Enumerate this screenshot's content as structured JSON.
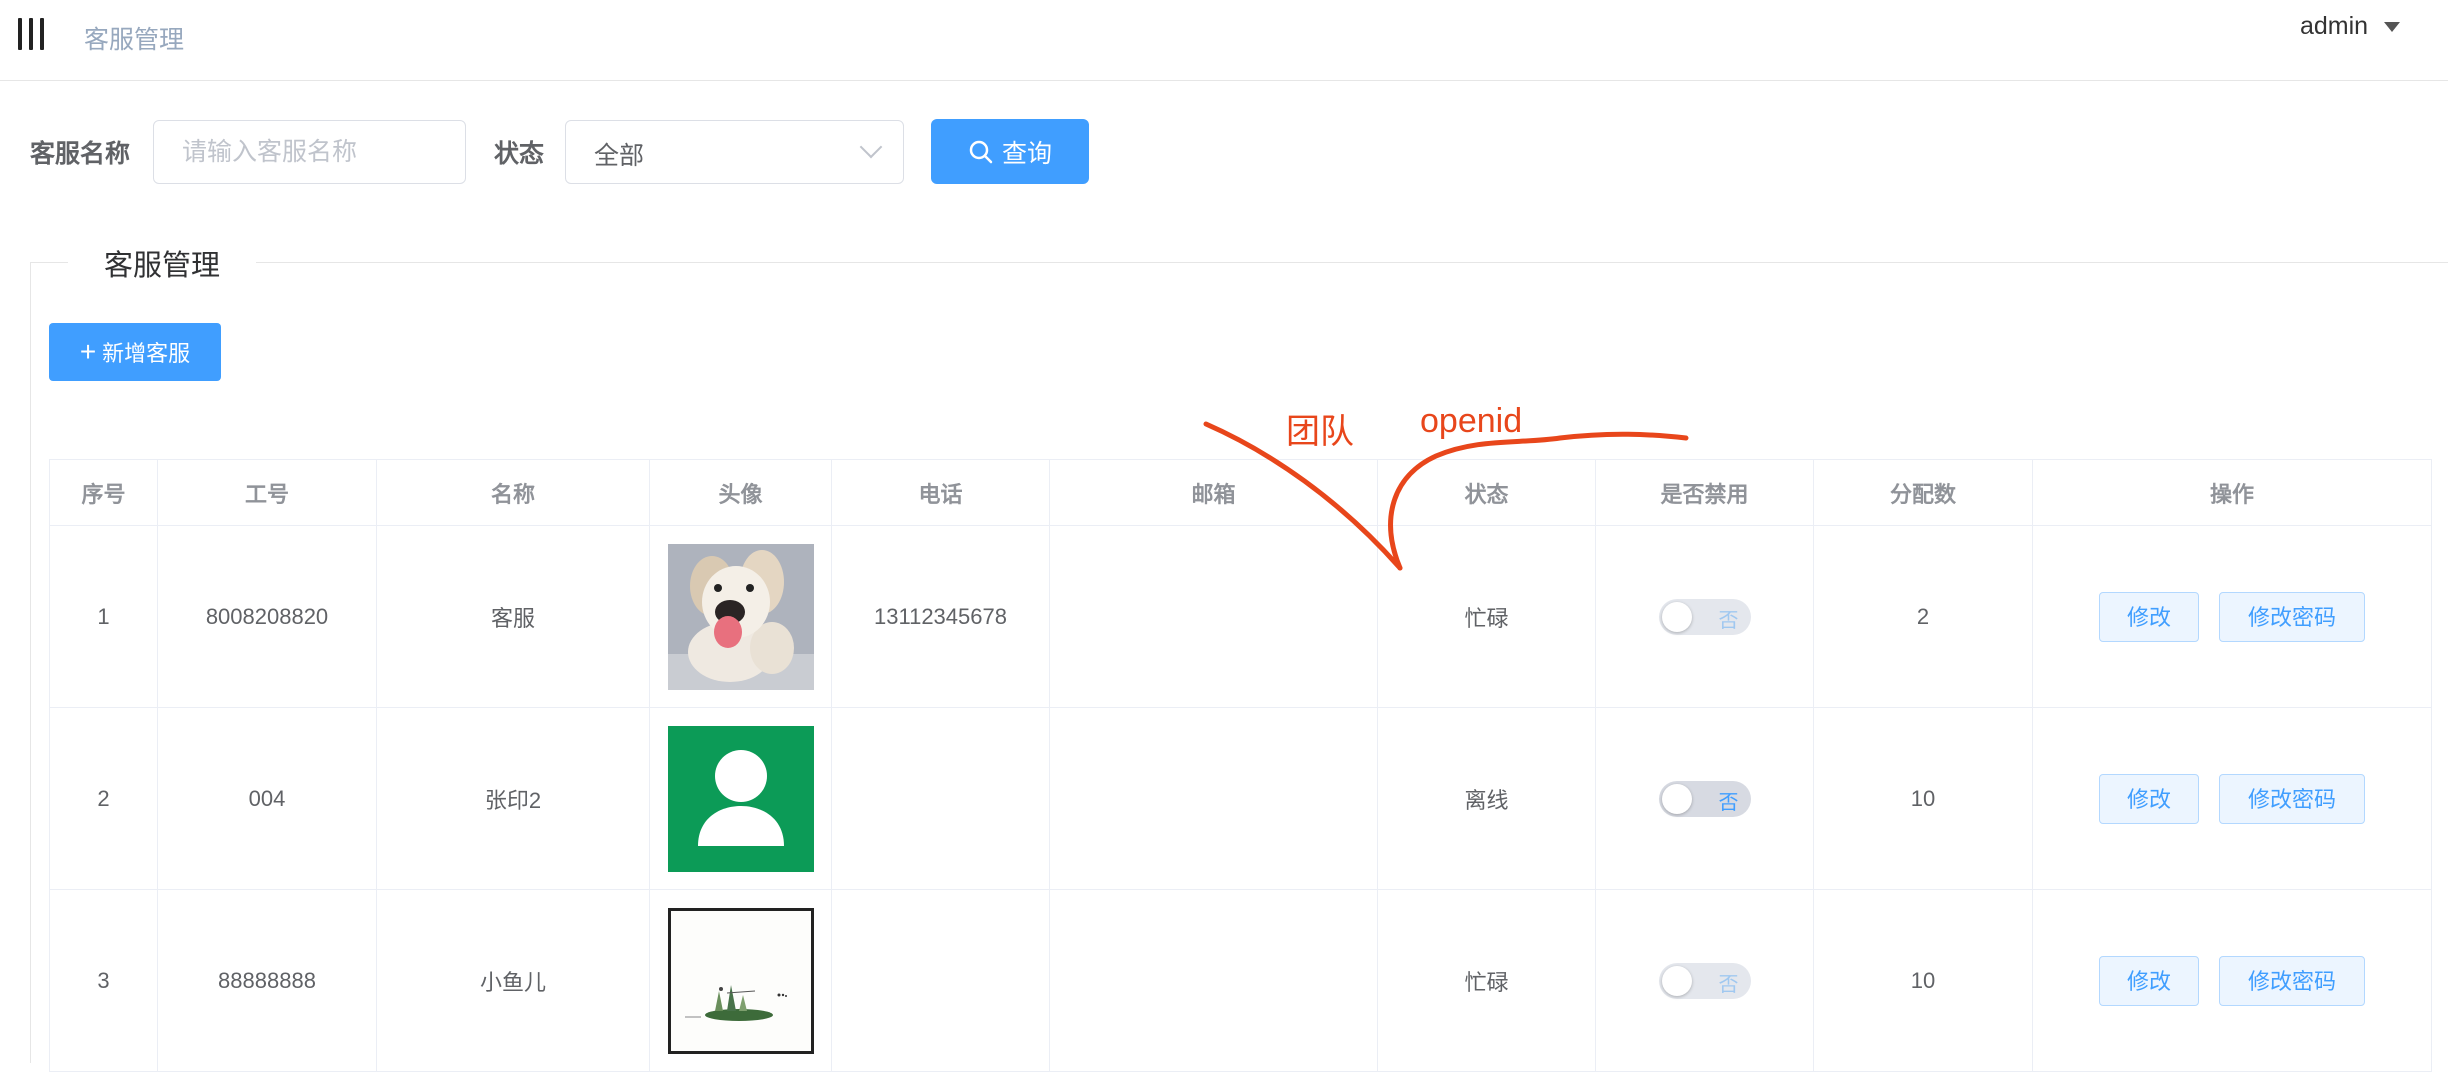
{
  "header": {
    "breadcrumb": "客服管理",
    "user": "admin"
  },
  "search": {
    "name_label": "客服名称",
    "name_placeholder": "请输入客服名称",
    "status_label": "状态",
    "status_value": "全部",
    "query_button": "查询"
  },
  "panel": {
    "title": "客服管理",
    "add_button": "新增客服"
  },
  "table": {
    "headers": [
      "序号",
      "工号",
      "名称",
      "头像",
      "电话",
      "邮箱",
      "状态",
      "是否禁用",
      "分配数",
      "操作"
    ],
    "rows": [
      {
        "index": "1",
        "job_no": "8008208820",
        "name": "客服",
        "avatar": "puppy-photo",
        "phone": "13112345678",
        "email": "",
        "status": "忙碌",
        "disabled": "否",
        "assigned": "2"
      },
      {
        "index": "2",
        "job_no": "004",
        "name": "张印2",
        "avatar": "default-user-icon",
        "phone": "",
        "email": "",
        "status": "离线",
        "disabled": "否",
        "assigned": "10"
      },
      {
        "index": "3",
        "job_no": "88888888",
        "name": "小鱼儿",
        "avatar": "ink-painting",
        "phone": "",
        "email": "",
        "status": "忙碌",
        "disabled": "否",
        "assigned": "10"
      }
    ],
    "edit_label": "修改",
    "change_password_label": "修改密码"
  },
  "annotations": {
    "team": "团队",
    "openid": "openid"
  },
  "colors": {
    "primary": "#409eff",
    "annotation": "#e8461b",
    "user_avatar_bg": "#0c9b57"
  }
}
